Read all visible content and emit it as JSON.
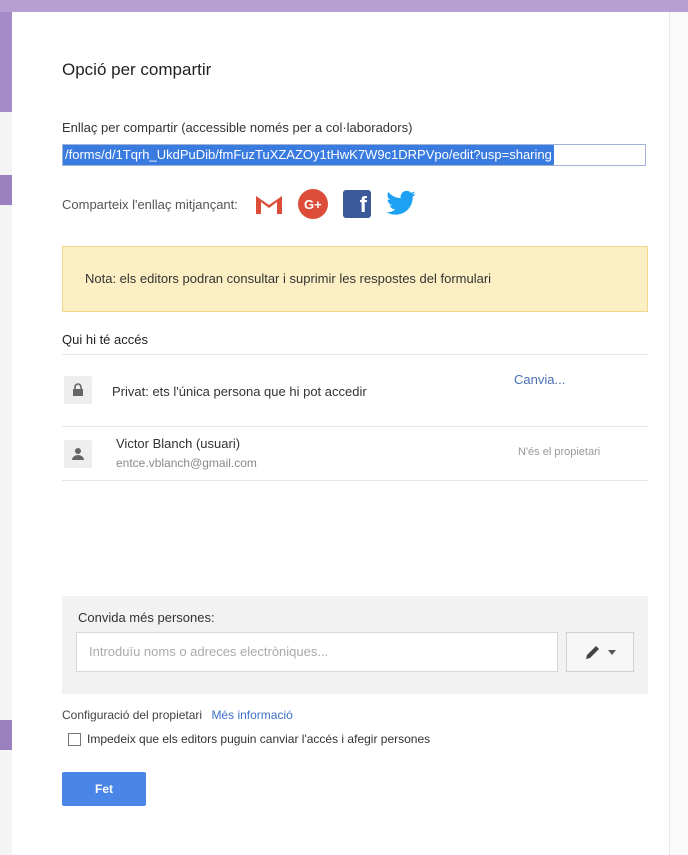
{
  "dialog": {
    "title": "Opció per compartir",
    "link_label": "Enllaç per compartir (accessible només per a col·laboradors)",
    "link_value": "/forms/d/1Tqrh_UkdPuDib/fmFuzTuXZAZOy1tHwK7W9c1DRPVpo/edit?usp=sharing",
    "share_via_label": "Comparteix l'enllaç mitjançant:",
    "share_icons": [
      "gmail-icon",
      "google-plus-icon",
      "facebook-icon",
      "twitter-icon"
    ],
    "gplus_text": "G+",
    "fb_text": "f",
    "note": "Nota: els editors podran consultar i suprimir les respostes del formulari",
    "access_title": "Qui hi té accés",
    "private_text": "Privat: ets l'única persona que hi pot accedir",
    "change_link": "Canvia...",
    "owner": {
      "name": "Victor Blanch (usuari)",
      "email": "entce.vblanch@gmail.com",
      "role": "N'és el propietari"
    },
    "invite": {
      "label": "Convida més persones:",
      "placeholder": "Introduïu noms o adreces electròniques..."
    },
    "owner_settings_label": "Configuració del propietari",
    "more_info": "Més informació",
    "checkbox_label": "Impedeix que els editors puguin canviar l'accés i afegir persones",
    "checkbox_checked": false,
    "done_button": "Fet"
  },
  "colors": {
    "accent_blue": "#4a86e8",
    "note_bg": "#fcefc3",
    "gmail_red": "#dd4b39",
    "facebook_blue": "#3b5998",
    "twitter_blue": "#1da1f2"
  }
}
